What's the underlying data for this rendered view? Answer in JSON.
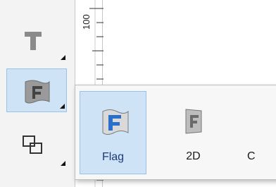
{
  "ruler": {
    "label": "100"
  },
  "toolbar": {
    "tools": [
      {
        "icon": "text-tool-icon"
      },
      {
        "icon": "warp-text-icon"
      },
      {
        "icon": "shapes-icon"
      }
    ]
  },
  "popup": {
    "options": [
      {
        "label": "Flag",
        "icon": "flag-warp-icon",
        "selected": true
      },
      {
        "label": "2D",
        "icon": "2d-warp-icon"
      },
      {
        "label": "C",
        "icon": "warp-option-icon"
      }
    ]
  },
  "colors": {
    "selection_bg": "#cfe3f6",
    "selection_border": "#9bc2e6",
    "icon_blue": "#2a6fc9"
  }
}
